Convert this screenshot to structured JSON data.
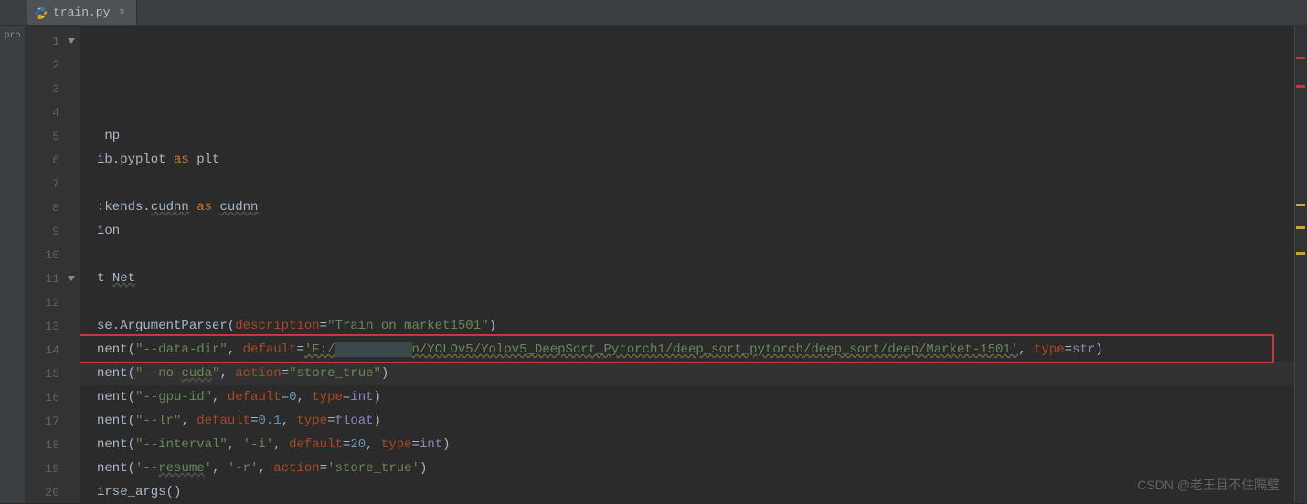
{
  "tab": {
    "filename": "train.py",
    "close_label": "×"
  },
  "sidebar": {
    "label": "pro"
  },
  "gutter": {
    "line_numbers": [
      "1",
      "2",
      "3",
      "4",
      "5",
      "6",
      "7",
      "8",
      "9",
      "10",
      "11",
      "12",
      "13",
      "14",
      "15",
      "16",
      "17",
      "18",
      "19",
      "20"
    ]
  },
  "code": {
    "lines": [
      {
        "n": 1,
        "parts": []
      },
      {
        "n": 2,
        "parts": []
      },
      {
        "n": 3,
        "parts": []
      },
      {
        "n": 4,
        "parts": []
      },
      {
        "n": 5,
        "parts": [
          {
            "t": " np",
            "cls": "ident"
          }
        ]
      },
      {
        "n": 6,
        "parts": [
          {
            "t": "ib.pyplot ",
            "cls": "ident"
          },
          {
            "t": "as",
            "cls": "kw"
          },
          {
            "t": " plt",
            "cls": "ident"
          }
        ]
      },
      {
        "n": 7,
        "parts": []
      },
      {
        "n": 8,
        "parts": [
          {
            "t": ":kends.",
            "cls": "ident"
          },
          {
            "t": "cudnn",
            "cls": "underline"
          },
          {
            "t": " ",
            "cls": "ident"
          },
          {
            "t": "as",
            "cls": "kw"
          },
          {
            "t": " ",
            "cls": "ident"
          },
          {
            "t": "cudnn",
            "cls": "underline"
          }
        ]
      },
      {
        "n": 9,
        "parts": [
          {
            "t": "ion",
            "cls": "ident"
          }
        ]
      },
      {
        "n": 10,
        "parts": []
      },
      {
        "n": 11,
        "parts": [
          {
            "t": "t ",
            "cls": "ident"
          },
          {
            "t": "Net",
            "cls": "underline"
          }
        ]
      },
      {
        "n": 12,
        "parts": []
      },
      {
        "n": 13,
        "parts": [
          {
            "t": "se.ArgumentParser(",
            "cls": "ident"
          },
          {
            "t": "description",
            "cls": "param"
          },
          {
            "t": "=",
            "cls": "ident"
          },
          {
            "t": "\"Train on market1501\"",
            "cls": "str"
          },
          {
            "t": ")",
            "cls": "ident"
          }
        ]
      },
      {
        "n": 14,
        "parts": [
          {
            "t": "nent(",
            "cls": "ident"
          },
          {
            "t": "\"--data-dir\"",
            "cls": "str"
          },
          {
            "t": ", ",
            "cls": "ident"
          },
          {
            "t": "default",
            "cls": "param"
          },
          {
            "t": "=",
            "cls": "ident"
          },
          {
            "t": "'F:/",
            "cls": "str str-underline"
          },
          {
            "t": "xxxxxxxxxx",
            "cls": "redacted"
          },
          {
            "t": "n/YOLOv5/Yolov5_DeepSort_Pytorch1/deep_sort_pytorch/deep_sort/deep/Market-1501'",
            "cls": "str str-underline"
          },
          {
            "t": ", ",
            "cls": "ident"
          },
          {
            "t": "type",
            "cls": "param"
          },
          {
            "t": "=",
            "cls": "ident"
          },
          {
            "t": "str",
            "cls": "builtin"
          },
          {
            "t": ")",
            "cls": "ident"
          }
        ]
      },
      {
        "n": 15,
        "parts": [
          {
            "t": "nent(",
            "cls": "ident"
          },
          {
            "t": "\"--no-",
            "cls": "str"
          },
          {
            "t": "cuda",
            "cls": "str underline"
          },
          {
            "t": "\"",
            "cls": "str"
          },
          {
            "t": ", ",
            "cls": "ident"
          },
          {
            "t": "action",
            "cls": "param"
          },
          {
            "t": "=",
            "cls": "ident"
          },
          {
            "t": "\"store_true\"",
            "cls": "str"
          },
          {
            "t": ")",
            "cls": "ident"
          }
        ]
      },
      {
        "n": 16,
        "parts": [
          {
            "t": "nent(",
            "cls": "ident"
          },
          {
            "t": "\"--gpu-id\"",
            "cls": "str"
          },
          {
            "t": ", ",
            "cls": "ident"
          },
          {
            "t": "default",
            "cls": "param"
          },
          {
            "t": "=",
            "cls": "ident"
          },
          {
            "t": "0",
            "cls": "num"
          },
          {
            "t": ", ",
            "cls": "ident"
          },
          {
            "t": "type",
            "cls": "param"
          },
          {
            "t": "=",
            "cls": "ident"
          },
          {
            "t": "int",
            "cls": "builtin"
          },
          {
            "t": ")",
            "cls": "ident"
          }
        ]
      },
      {
        "n": 17,
        "parts": [
          {
            "t": "nent(",
            "cls": "ident"
          },
          {
            "t": "\"--lr\"",
            "cls": "str"
          },
          {
            "t": ", ",
            "cls": "ident"
          },
          {
            "t": "default",
            "cls": "param"
          },
          {
            "t": "=",
            "cls": "ident"
          },
          {
            "t": "0.1",
            "cls": "num"
          },
          {
            "t": ", ",
            "cls": "ident"
          },
          {
            "t": "type",
            "cls": "param"
          },
          {
            "t": "=",
            "cls": "ident"
          },
          {
            "t": "float",
            "cls": "builtin"
          },
          {
            "t": ")",
            "cls": "ident"
          }
        ]
      },
      {
        "n": 18,
        "parts": [
          {
            "t": "nent(",
            "cls": "ident"
          },
          {
            "t": "\"--interval\"",
            "cls": "str"
          },
          {
            "t": ", ",
            "cls": "ident"
          },
          {
            "t": "'-i'",
            "cls": "str"
          },
          {
            "t": ", ",
            "cls": "ident"
          },
          {
            "t": "default",
            "cls": "param"
          },
          {
            "t": "=",
            "cls": "ident"
          },
          {
            "t": "20",
            "cls": "num"
          },
          {
            "t": ", ",
            "cls": "ident"
          },
          {
            "t": "type",
            "cls": "param"
          },
          {
            "t": "=",
            "cls": "ident"
          },
          {
            "t": "int",
            "cls": "builtin"
          },
          {
            "t": ")",
            "cls": "ident"
          }
        ]
      },
      {
        "n": 19,
        "parts": [
          {
            "t": "nent(",
            "cls": "ident"
          },
          {
            "t": "'--",
            "cls": "str"
          },
          {
            "t": "resume",
            "cls": "str underline"
          },
          {
            "t": "'",
            "cls": "str"
          },
          {
            "t": ", ",
            "cls": "ident"
          },
          {
            "t": "'-r'",
            "cls": "str"
          },
          {
            "t": ", ",
            "cls": "ident"
          },
          {
            "t": "action",
            "cls": "param"
          },
          {
            "t": "=",
            "cls": "ident"
          },
          {
            "t": "'store_true'",
            "cls": "str"
          },
          {
            "t": ")",
            "cls": "ident"
          }
        ]
      },
      {
        "n": 20,
        "parts": [
          {
            "t": "irse_args()",
            "cls": "ident"
          }
        ]
      }
    ]
  },
  "highlight": {
    "line": 14
  },
  "caret_line": 15,
  "watermark": "CSDN @老王且不住隔壁",
  "markers": [
    {
      "pos": 34,
      "type": "error"
    },
    {
      "pos": 65,
      "type": "error"
    },
    {
      "pos": 195,
      "type": "warn"
    },
    {
      "pos": 220,
      "type": "warn"
    },
    {
      "pos": 248,
      "type": "warn"
    }
  ]
}
